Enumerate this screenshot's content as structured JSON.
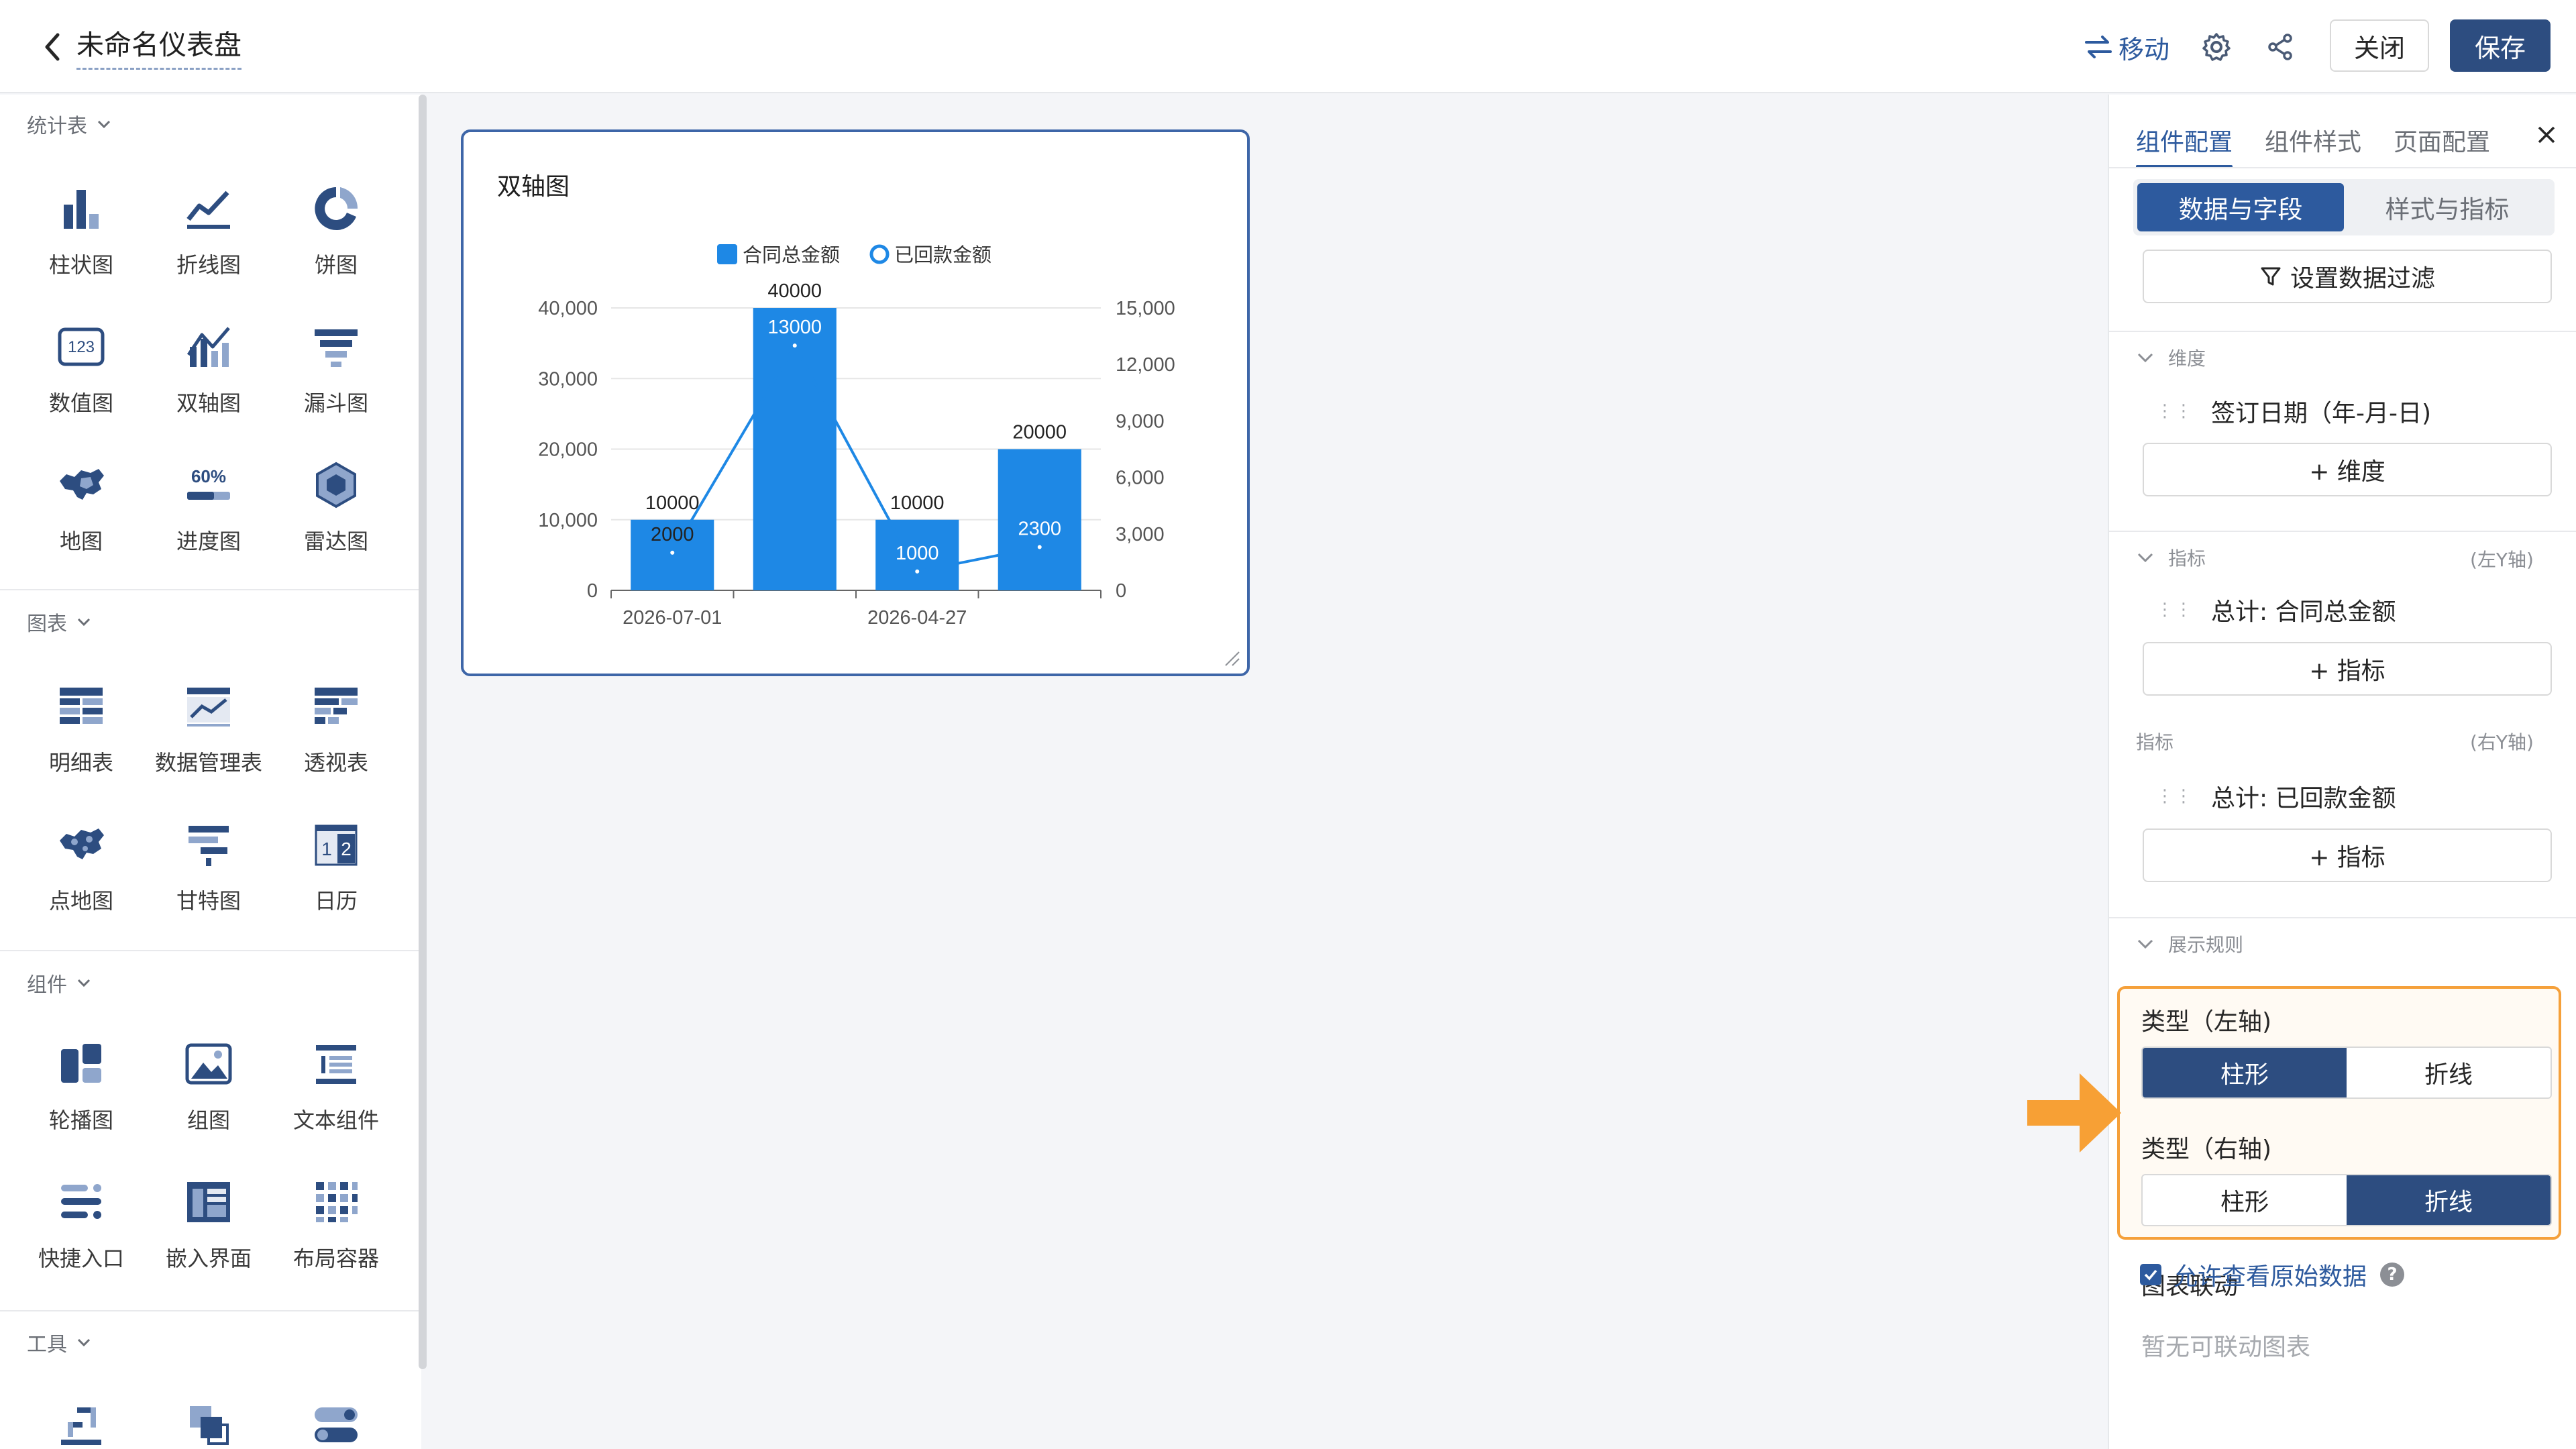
{
  "header": {
    "title": "未命名仪表盘",
    "move_label": "移动",
    "close_label": "关闭",
    "save_label": "保存"
  },
  "left_panel": {
    "sections": [
      {
        "title": "统计表",
        "items": [
          {
            "label": "柱状图",
            "icon": "bar-chart-icon"
          },
          {
            "label": "折线图",
            "icon": "line-chart-icon"
          },
          {
            "label": "饼图",
            "icon": "pie-chart-icon"
          },
          {
            "label": "数值图",
            "icon": "number-chart-icon",
            "icon_text": "123"
          },
          {
            "label": "双轴图",
            "icon": "dual-axis-chart-icon"
          },
          {
            "label": "漏斗图",
            "icon": "funnel-chart-icon"
          },
          {
            "label": "地图",
            "icon": "map-chart-icon"
          },
          {
            "label": "进度图",
            "icon": "progress-chart-icon",
            "icon_text": "60%"
          },
          {
            "label": "雷达图",
            "icon": "radar-chart-icon"
          }
        ]
      },
      {
        "title": "图表",
        "items": [
          {
            "label": "明细表",
            "icon": "detail-table-icon"
          },
          {
            "label": "数据管理表",
            "icon": "data-management-table-icon"
          },
          {
            "label": "透视表",
            "icon": "pivot-table-icon"
          },
          {
            "label": "点地图",
            "icon": "point-map-icon"
          },
          {
            "label": "甘特图",
            "icon": "gantt-chart-icon"
          },
          {
            "label": "日历",
            "icon": "calendar-icon",
            "icon_text": [
              "1",
              "2"
            ]
          }
        ]
      },
      {
        "title": "组件",
        "items": [
          {
            "label": "轮播图",
            "icon": "carousel-icon"
          },
          {
            "label": "组图",
            "icon": "image-group-icon"
          },
          {
            "label": "文本组件",
            "icon": "text-component-icon"
          },
          {
            "label": "快捷入口",
            "icon": "shortcut-entry-icon"
          },
          {
            "label": "嵌入界面",
            "icon": "embed-page-icon"
          },
          {
            "label": "布局容器",
            "icon": "layout-container-icon"
          }
        ]
      },
      {
        "title": "工具",
        "items": [
          {
            "label": "",
            "icon": "tool-step-icon"
          },
          {
            "label": "",
            "icon": "tool-layer-icon"
          },
          {
            "label": "",
            "icon": "tool-toggle-icon"
          }
        ]
      }
    ]
  },
  "chart_card": {
    "title": "双轴图",
    "chart_data": {
      "type": "bar",
      "categories": [
        "2026-07-01",
        "",
        "2026-04-27",
        ""
      ],
      "x_tick_labels": [
        "2026-07-01",
        "2026-04-27"
      ],
      "series": [
        {
          "name": "合同总金额",
          "type": "bar",
          "axis": "left",
          "values": [
            10000,
            40000,
            10000,
            20000
          ],
          "color": "#1e88e5"
        },
        {
          "name": "已回款金额",
          "type": "line",
          "axis": "right",
          "values": [
            2000,
            13000,
            1000,
            2300
          ],
          "color": "#1e88e5"
        }
      ],
      "left_axis": {
        "ticks": [
          "0",
          "10,000",
          "20,000",
          "30,000",
          "40,000"
        ],
        "min": 0,
        "max": 40000
      },
      "right_axis": {
        "ticks": [
          "0",
          "3,000",
          "6,000",
          "9,000",
          "12,000",
          "15,000"
        ],
        "min": 0,
        "max": 15000
      },
      "legend": "top-center",
      "grid": true
    }
  },
  "right_panel": {
    "tabs": [
      "组件配置",
      "组件样式",
      "页面配置"
    ],
    "sub_tabs": [
      "数据与字段",
      "样式与指标"
    ],
    "filter_label": "设置数据过滤",
    "dimension": {
      "title": "维度",
      "field": "签订日期（年-月-日)",
      "add_label": "+ 维度"
    },
    "metrics_left": {
      "title": "指标",
      "axis": "(左Y轴)",
      "field": "总计:  合同总金额",
      "add_label": "+ 指标"
    },
    "metrics_right": {
      "title": "指标",
      "axis": "(右Y轴)",
      "field": "总计:  已回款金额",
      "add_label": "+ 指标"
    },
    "display_rules": {
      "title": "展示规则",
      "left_type_label": "类型（左轴)",
      "right_type_label": "类型（右轴)",
      "options": [
        "柱形",
        "折线"
      ],
      "left_selected": "柱形",
      "right_selected": "折线"
    },
    "allow_raw_label": "允许查看原始数据",
    "allow_raw_checked": true,
    "linkage_label": "图表联动",
    "linkage_empty": "暂无可联动图表"
  },
  "colors": {
    "accent": "#2d5a9e",
    "save_button": "#2d4d80",
    "bar": "#1e88e5",
    "highlight_border": "#f5a03a",
    "arrow": "#f7a035"
  }
}
